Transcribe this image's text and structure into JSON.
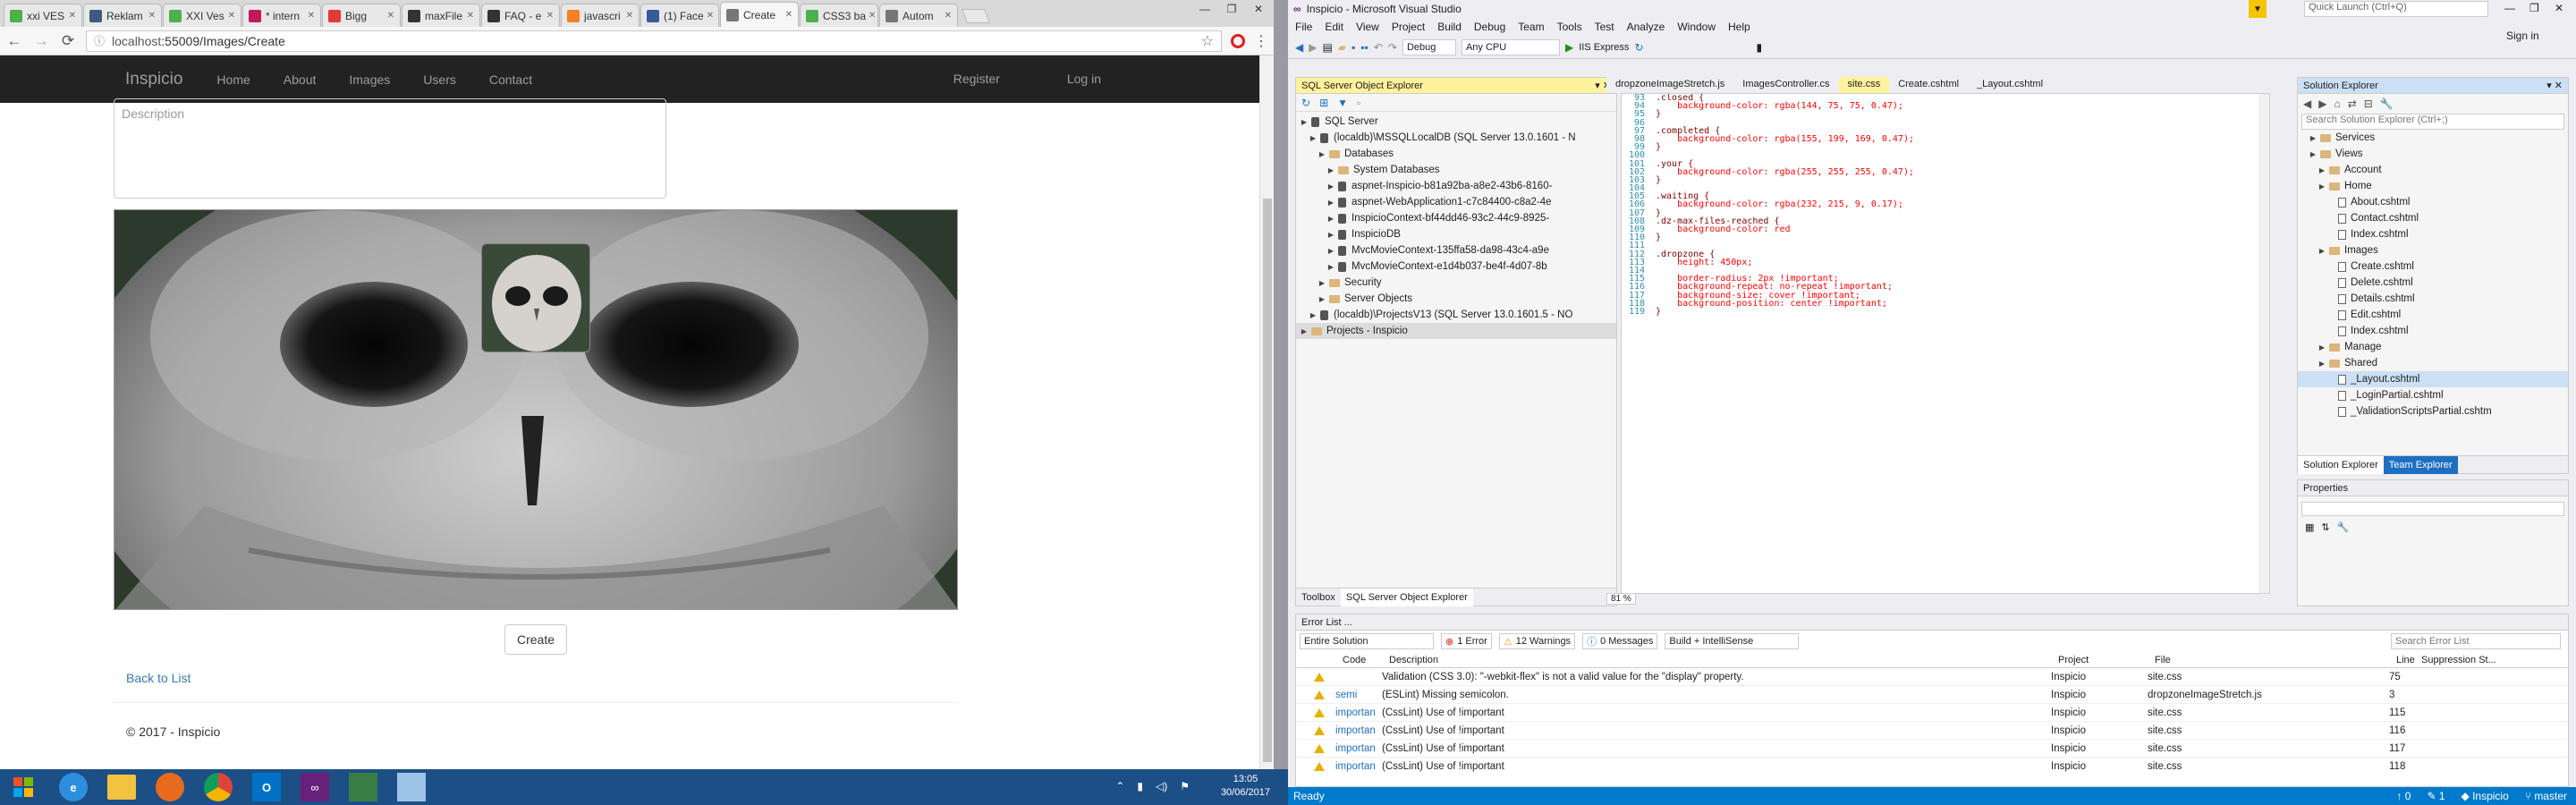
{
  "browser": {
    "tabs": [
      {
        "label": "xxi VES",
        "color": "#4caf50"
      },
      {
        "label": "Reklam",
        "color": "#3d5a80"
      },
      {
        "label": "XXI Ves",
        "color": "#4caf50"
      },
      {
        "label": "* intern",
        "color": "#c2185b"
      },
      {
        "label": "Bigg",
        "color": "#e53935"
      },
      {
        "label": "maxFile",
        "color": "#333333"
      },
      {
        "label": "FAQ - e",
        "color": "#333333"
      },
      {
        "label": "javascri",
        "color": "#f48024"
      },
      {
        "label": "(1) Face",
        "color": "#3b5998"
      },
      {
        "label": "Create",
        "color": "#777777",
        "active": true
      },
      {
        "label": "CSS3 ba",
        "color": "#4caf50"
      },
      {
        "label": "Autom",
        "color": "#777777"
      }
    ],
    "url_host": "localhost",
    "url_path": ":55009/Images/Create"
  },
  "site": {
    "brand": "Inspicio",
    "nav": [
      "Home",
      "About",
      "Images",
      "Users",
      "Contact"
    ],
    "nav_right": [
      "Register",
      "Log in"
    ],
    "description_placeholder": "Description",
    "create_label": "Create",
    "back_label": "Back to List",
    "footer": "© 2017 - Inspicio"
  },
  "vs": {
    "title": "Inspicio - Microsoft Visual Studio",
    "quick_launch": "Quick Launch (Ctrl+Q)",
    "sign_in": "Sign in",
    "menu": [
      "File",
      "Edit",
      "View",
      "Project",
      "Build",
      "Debug",
      "Team",
      "Tools",
      "Test",
      "Analyze",
      "Window",
      "Help"
    ],
    "toolbar": {
      "config": "Debug",
      "platform": "Any CPU",
      "run": "IIS Express"
    },
    "sql_explorer": {
      "title": "SQL Server Object Explorer",
      "items": [
        {
          "label": "SQL Server",
          "indent": 0,
          "type": "server"
        },
        {
          "label": "(localdb)\\MSSQLLocalDB (SQL Server 13.0.1601 - N",
          "indent": 1,
          "type": "db"
        },
        {
          "label": "Databases",
          "indent": 2,
          "type": "folder"
        },
        {
          "label": "System Databases",
          "indent": 3,
          "type": "folder"
        },
        {
          "label": "aspnet-Inspicio-b81a92ba-a8e2-43b6-8160-",
          "indent": 3,
          "type": "db"
        },
        {
          "label": "aspnet-WebApplication1-c7c84400-c8a2-4e",
          "indent": 3,
          "type": "db"
        },
        {
          "label": "InspicioContext-bf44dd46-93c2-44c9-8925-",
          "indent": 3,
          "type": "db"
        },
        {
          "label": "InspicioDB",
          "indent": 3,
          "type": "db"
        },
        {
          "label": "MvcMovieContext-135ffa58-da98-43c4-a9e",
          "indent": 3,
          "type": "db"
        },
        {
          "label": "MvcMovieContext-e1d4b037-be4f-4d07-8b",
          "indent": 3,
          "type": "db"
        },
        {
          "label": "Security",
          "indent": 2,
          "type": "folder"
        },
        {
          "label": "Server Objects",
          "indent": 2,
          "type": "folder"
        },
        {
          "label": "(localdb)\\ProjectsV13 (SQL Server 13.0.1601.5 - NO",
          "indent": 1,
          "type": "db"
        },
        {
          "label": "Projects - Inspicio",
          "indent": 0,
          "type": "folder",
          "selected": true
        }
      ],
      "bottom_tabs": [
        "Toolbox",
        "SQL Server Object Explorer"
      ]
    },
    "doc_tabs": [
      "dropzoneImageStretch.js",
      "ImagesController.cs",
      "site.css",
      "Create.cshtml",
      "_Layout.cshtml"
    ],
    "active_doc": "site.css",
    "code": [
      {
        "n": "93",
        "t": ".closed {",
        "k": "sel"
      },
      {
        "n": "94",
        "t": "    background-color: rgba(144, 75, 75, 0.47);",
        "k": "decl"
      },
      {
        "n": "95",
        "t": "}",
        "k": "sel"
      },
      {
        "n": "96",
        "t": "",
        "k": "sel"
      },
      {
        "n": "97",
        "t": ".completed {",
        "k": "sel"
      },
      {
        "n": "98",
        "t": "    background-color: rgba(155, 199, 169, 0.47);",
        "k": "decl"
      },
      {
        "n": "99",
        "t": "}",
        "k": "sel"
      },
      {
        "n": "100",
        "t": "",
        "k": "sel"
      },
      {
        "n": "101",
        "t": ".your {",
        "k": "sel"
      },
      {
        "n": "102",
        "t": "    background-color: rgba(255, 255, 255, 0.47);",
        "k": "decl"
      },
      {
        "n": "103",
        "t": "}",
        "k": "sel"
      },
      {
        "n": "104",
        "t": "",
        "k": "sel"
      },
      {
        "n": "105",
        "t": ".waiting {",
        "k": "sel"
      },
      {
        "n": "106",
        "t": "    background-color: rgba(232, 215, 9, 0.17);",
        "k": "decl"
      },
      {
        "n": "107",
        "t": "}",
        "k": "sel"
      },
      {
        "n": "108",
        "t": ".dz-max-files-reached {",
        "k": "sel"
      },
      {
        "n": "109",
        "t": "    background-color: red",
        "k": "decl"
      },
      {
        "n": "110",
        "t": "}",
        "k": "sel"
      },
      {
        "n": "111",
        "t": "",
        "k": "sel"
      },
      {
        "n": "112",
        "t": ".dropzone {",
        "k": "sel"
      },
      {
        "n": "113",
        "t": "    height: 450px;",
        "k": "decl"
      },
      {
        "n": "114",
        "t": "",
        "k": "sel"
      },
      {
        "n": "115",
        "t": "    border-radius: 2px !important;",
        "k": "decl"
      },
      {
        "n": "116",
        "t": "    background-repeat: no-repeat !important;",
        "k": "decl"
      },
      {
        "n": "117",
        "t": "    background-size: cover !important;",
        "k": "decl"
      },
      {
        "n": "118",
        "t": "    background-position: center !important;",
        "k": "decl"
      },
      {
        "n": "119",
        "t": "}",
        "k": "sel"
      }
    ],
    "zoom": "81 %",
    "solution_explorer": {
      "title": "Solution Explorer",
      "search_placeholder": "Search Solution Explorer (Ctrl+;)",
      "items": [
        {
          "label": "Services",
          "indent": 0,
          "type": "folder"
        },
        {
          "label": "Views",
          "indent": 0,
          "type": "folder"
        },
        {
          "label": "Account",
          "indent": 1,
          "type": "folder"
        },
        {
          "label": "Home",
          "indent": 1,
          "type": "folder"
        },
        {
          "label": "About.cshtml",
          "indent": 2,
          "type": "file"
        },
        {
          "label": "Contact.cshtml",
          "indent": 2,
          "type": "file"
        },
        {
          "label": "Index.cshtml",
          "indent": 2,
          "type": "file"
        },
        {
          "label": "Images",
          "indent": 1,
          "type": "folder"
        },
        {
          "label": "Create.cshtml",
          "indent": 2,
          "type": "file"
        },
        {
          "label": "Delete.cshtml",
          "indent": 2,
          "type": "file"
        },
        {
          "label": "Details.cshtml",
          "indent": 2,
          "type": "file"
        },
        {
          "label": "Edit.cshtml",
          "indent": 2,
          "type": "file"
        },
        {
          "label": "Index.cshtml",
          "indent": 2,
          "type": "file"
        },
        {
          "label": "Manage",
          "indent": 1,
          "type": "folder"
        },
        {
          "label": "Shared",
          "indent": 1,
          "type": "folder"
        },
        {
          "label": "_Layout.cshtml",
          "indent": 2,
          "type": "file",
          "selected": true
        },
        {
          "label": "_LoginPartial.cshtml",
          "indent": 2,
          "type": "file"
        },
        {
          "label": "_ValidationScriptsPartial.cshtm",
          "indent": 2,
          "type": "file"
        }
      ],
      "tabs": [
        "Solution Explorer",
        "Team Explorer"
      ]
    },
    "properties_title": "Properties",
    "error_list": {
      "title": "Error List ...",
      "scope": "Entire Solution",
      "errors": "1 Error",
      "warnings": "12 Warnings",
      "messages": "0 Messages",
      "build_filter": "Build + IntelliSense",
      "search_placeholder": "Search Error List",
      "columns": [
        "Code",
        "Description",
        "Project",
        "File",
        "Line",
        "Suppression St..."
      ],
      "rows": [
        {
          "code": "",
          "desc": "Validation (CSS 3.0): \"-webkit-flex\" is not a valid value for the \"display\" property.",
          "project": "Inspicio",
          "file": "site.css",
          "line": "75"
        },
        {
          "code": "semi",
          "desc": "(ESLint) Missing semicolon.",
          "project": "Inspicio",
          "file": "dropzoneImageStretch.js",
          "line": "3"
        },
        {
          "code": "importan",
          "desc": "(CssLint) Use of !important",
          "project": "Inspicio",
          "file": "site.css",
          "line": "115"
        },
        {
          "code": "importan",
          "desc": "(CssLint) Use of !important",
          "project": "Inspicio",
          "file": "site.css",
          "line": "116"
        },
        {
          "code": "importan",
          "desc": "(CssLint) Use of !important",
          "project": "Inspicio",
          "file": "site.css",
          "line": "117"
        },
        {
          "code": "importan",
          "desc": "(CssLint) Use of !important",
          "project": "Inspicio",
          "file": "site.css",
          "line": "118"
        }
      ]
    },
    "status": {
      "ready": "Ready",
      "up": "0",
      "pencil": "1",
      "project": "Inspicio",
      "branch": "master"
    }
  },
  "taskbar": {
    "time": "13:05",
    "date": "30/06/2017"
  },
  "colors": {
    "vs_blue": "#007acc",
    "taskbar": "#1c4f86",
    "navbar": "#222222"
  }
}
